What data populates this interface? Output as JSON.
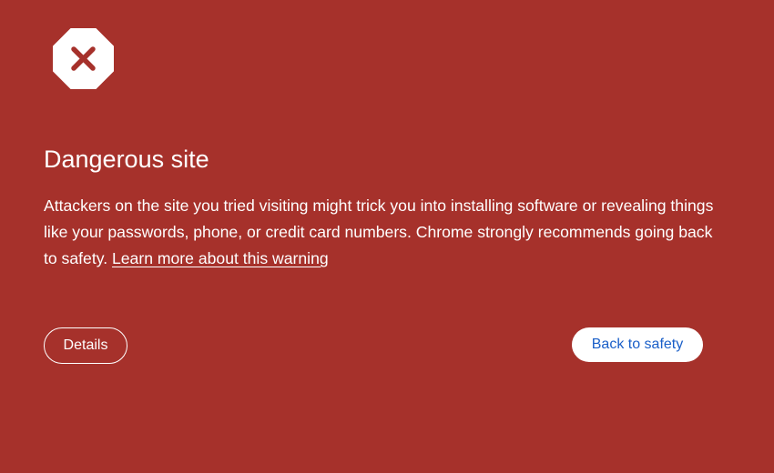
{
  "page": {
    "background_color": "#a6312b",
    "icon": "danger-octagon-x-icon"
  },
  "warning": {
    "title": "Dangerous site",
    "body": "Attackers on the site you tried visiting might trick you into installing software or revealing things like your passwords, phone, or credit card numbers. Chrome strongly recommends going back to safety.",
    "learn_more_link": "Learn more about this warning"
  },
  "buttons": {
    "details_label": "Details",
    "back_label": "Back to safety",
    "back_text_color": "#1a5fc8"
  }
}
